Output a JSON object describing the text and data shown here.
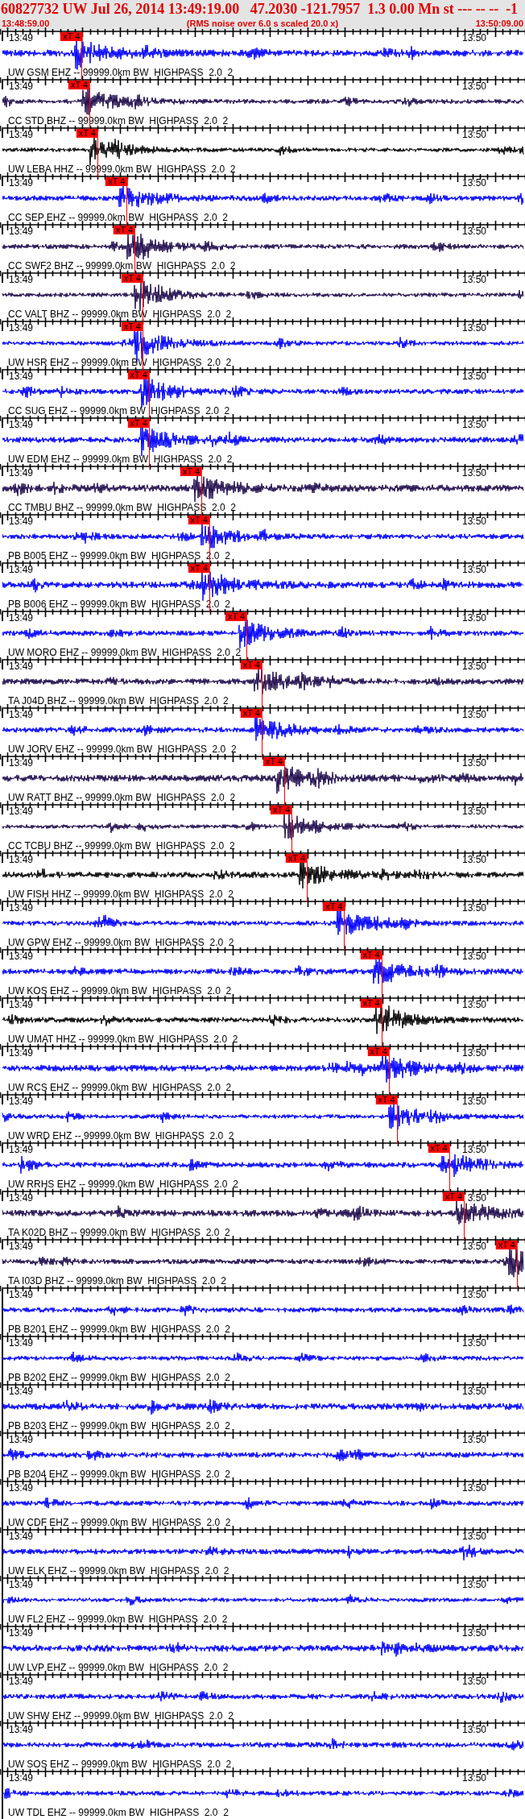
{
  "header": {
    "title": "60827732 UW Jul 26, 2014 13:49:19.00   47.2030 -121.7957  1.3 0.00 Mn st --- -- --  -1",
    "start_time": "13:48:59.00",
    "note": "(RMS noise over 6.0 s scaled 20.0 x)",
    "end_time": "13:50:09.00"
  },
  "traces": [
    {
      "label": "UW GSM EHZ -- 99999.0km BW  HIGHPASS  2.0  2",
      "color": "#0000ff",
      "start_label": "13:49",
      "end_label": "13:50",
      "pick": {
        "label": "xT 4",
        "level": 0.157
      }
    },
    {
      "label": "CC STD BHZ -- 99999.0km BW  HIGHPASS  2.0  2",
      "color": "#1e0a4b",
      "start_label": "13:49",
      "end_label": "13:50",
      "pick": {
        "label": "xT 4",
        "level": 0.172
      }
    },
    {
      "label": "UW LEBA HHZ -- 99999.0km BW  HIGHPASS  2.0  2",
      "color": "#000000",
      "start_label": "13:49",
      "end_label": "13:50",
      "pick": {
        "label": "xT 4",
        "level": 0.187
      }
    },
    {
      "label": "CC SEP EHZ -- 99999.0km BW  HIGHPASS  2.0  2",
      "color": "#0000ff",
      "start_label": "13:49",
      "end_label": "13:50",
      "pick": {
        "label": "xT 4",
        "level": 0.243
      }
    },
    {
      "label": "CC SWF2 BHZ -- 99999.0km BW  HIGHPASS  2.0  2",
      "color": "#1e0a4b",
      "start_label": "13:49",
      "end_label": "13:50",
      "pick": {
        "label": "xT 4",
        "level": 0.258
      }
    },
    {
      "label": "CC VALT BHZ -- 99999.0km BW  HIGHPASS  2.0  2",
      "color": "#1e0a4b",
      "start_label": "13:49",
      "end_label": "13:50",
      "pick": {
        "label": "xT 4",
        "level": 0.273
      }
    },
    {
      "label": "UW HSR EHZ -- 99999.0km BW  HIGHPASS  2.0  2",
      "color": "#0000ff",
      "start_label": "13:49",
      "end_label": "13:50",
      "pick": {
        "label": "xT 4",
        "level": 0.273
      }
    },
    {
      "label": "CC SUG EHZ -- 99999.0km BW  HIGHPASS  2.0  2",
      "color": "#0000ff",
      "start_label": "13:49",
      "end_label": "13:50",
      "pick": {
        "label": "xT 4",
        "level": 0.285
      }
    },
    {
      "label": "UW EDM EHZ -- 99999.0km BW  HIGHPASS  2.0  2",
      "color": "#0000ff",
      "start_label": "13:49",
      "end_label": "13:50",
      "pick": {
        "label": "xT 4",
        "level": 0.285
      }
    },
    {
      "label": "CC TMBU BHZ -- 99999.0km BW  HIGHPASS  2.0  2",
      "color": "#1e0a4b",
      "start_label": "13:49",
      "end_label": "13:50",
      "pick": {
        "label": "xT 4",
        "level": 0.385
      }
    },
    {
      "label": "PB B005 EHZ -- 99999.0km BW  HIGHPASS  2.0  2",
      "color": "#0000ff",
      "start_label": "13:49",
      "end_label": "13:50",
      "pick": {
        "label": "xT 4",
        "level": 0.4
      }
    },
    {
      "label": "PB B006 EHZ -- 99999.0km BW  HIGHPASS  2.0  2",
      "color": "#0000ff",
      "start_label": "13:49",
      "end_label": "13:50",
      "pick": {
        "label": "xT 4",
        "level": 0.4
      }
    },
    {
      "label": "UW MORO EHZ -- 99999.0km BW  HIGHPASS  2.0  2",
      "color": "#0000ff",
      "start_label": "13:49",
      "end_label": "13:50",
      "pick": {
        "label": "xT 4",
        "level": 0.471
      }
    },
    {
      "label": "TA J04D BHZ -- 99999.0km BW  HIGHPASS  2.0  2",
      "color": "#1e0a4b",
      "start_label": "13:49",
      "end_label": "13:50",
      "pick": {
        "label": "xT 4",
        "level": 0.5
      }
    },
    {
      "label": "UW JORV EHZ -- 99999.0km BW  HIGHPASS  2.0  2",
      "color": "#0000ff",
      "start_label": "13:49",
      "end_label": "13:50",
      "pick": {
        "label": "xT 4",
        "level": 0.5
      }
    },
    {
      "label": "UW RATT BHZ -- 99999.0km BW  HIGHPASS  2.0  2",
      "color": "#1e0a4b",
      "start_label": "13:49",
      "end_label": "13:50",
      "pick": {
        "label": "xT 4",
        "level": 0.543
      }
    },
    {
      "label": "CC TCBU BHZ -- 99999.0km BW  HIGHPASS  2.0  2",
      "color": "#1e0a4b",
      "start_label": "13:49",
      "end_label": "13:50",
      "pick": {
        "label": "xT 4",
        "level": 0.557
      }
    },
    {
      "label": "UW FISH HHZ -- 99999.0km BW  HIGHPASS  2.0  2",
      "color": "#000000",
      "start_label": "13:49",
      "end_label": "13:50",
      "pick": {
        "label": "xT 4",
        "level": 0.586
      }
    },
    {
      "label": "UW GPW EHZ -- 99999.0km BW  HIGHPASS  2.0  2",
      "color": "#0000ff",
      "start_label": "13:49",
      "end_label": "13:50",
      "pick": {
        "label": "xT 4",
        "level": 0.657
      }
    },
    {
      "label": "UW KOS EHZ -- 99999.0km BW  HIGHPASS  2.0  2",
      "color": "#0000ff",
      "start_label": "13:49",
      "end_label": "13:50",
      "pick": {
        "label": "xT 4",
        "level": 0.728
      }
    },
    {
      "label": "UW UMAT HHZ -- 99999.0km BW  HIGHPASS  2.0  2",
      "color": "#000000",
      "start_label": "13:49",
      "end_label": "13:50",
      "pick": {
        "label": "xT 4",
        "level": 0.728
      }
    },
    {
      "label": "UW RCS EHZ -- 99999.0km BW  HIGHPASS  2.0  2",
      "color": "#0000ff",
      "start_label": "13:49",
      "end_label": "13:50",
      "pick": {
        "label": "xT 4",
        "level": 0.742
      }
    },
    {
      "label": "UW WRD EHZ -- 99999.0km BW  HIGHPASS  2.0  2",
      "color": "#0000ff",
      "start_label": "13:49",
      "end_label": "13:50",
      "pick": {
        "label": "xT 4",
        "level": 0.757
      }
    },
    {
      "label": "UW RRHS EHZ -- 99999.0km BW  HIGHPASS  2.0  2",
      "color": "#0000ff",
      "start_label": "13:49",
      "end_label": "13:50",
      "pick": {
        "label": "xT 4",
        "level": 0.857
      }
    },
    {
      "label": "TA K02D BHZ -- 99999.0km BW  HIGHPASS  2.0  2",
      "color": "#1e0a4b",
      "start_label": "13:49",
      "end_label": "3:50",
      "pick": {
        "label": "xT 4",
        "level": 0.885
      }
    },
    {
      "label": "TA I03D BHZ -- 99999.0km BW  HIGHPASS  2.0  2",
      "color": "#1e0a4b",
      "start_label": "13:49",
      "end_label": "13:50",
      "pick": {
        "label": "xT 4",
        "level": 0.986
      }
    },
    {
      "label": "PB B201 EHZ -- 99999.0km BW  HIGHPASS  2.0  2",
      "color": "#0000ff",
      "start_label": "13:49",
      "end_label": "13:50"
    },
    {
      "label": "PB B202 EHZ -- 99999.0km BW  HIGHPASS  2.0  2",
      "color": "#0000ff",
      "start_label": "13:49",
      "end_label": "13:50"
    },
    {
      "label": "PB B203 EHZ -- 99999.0km BW  HIGHPASS  2.0  2",
      "color": "#0000ff",
      "start_label": "13:49",
      "end_label": "13:50"
    },
    {
      "label": "PB B204 EHZ -- 99999.0km BW  HIGHPASS  2.0  2",
      "color": "#0000ff",
      "start_label": "13:49",
      "end_label": "13:50"
    },
    {
      "label": "UW CDF EHZ -- 99999.0km BW  HIGHPASS  2.0  2",
      "color": "#0000ff",
      "start_label": "13:49",
      "end_label": "13:50"
    },
    {
      "label": "UW ELK EHZ -- 99999.0km BW  HIGHPASS  2.0  2",
      "color": "#0000ff",
      "start_label": "13:49",
      "end_label": "13:50"
    },
    {
      "label": "UW FL2 EHZ -- 99999.0km BW  HIGHPASS  2.0  2",
      "color": "#0000ff",
      "start_label": "13:49",
      "end_label": "13:50"
    },
    {
      "label": "UW LVP EHZ -- 99999.0km BW  HIGHPASS  2.0  2",
      "color": "#0000ff",
      "start_label": "13:49",
      "end_label": "13:50"
    },
    {
      "label": "UW SHW EHZ -- 99999.0km BW  HIGHPASS  2.0  2",
      "color": "#0000ff",
      "start_label": "13:49",
      "end_label": "13:50"
    },
    {
      "label": "UW SOS EHZ -- 99999.0km BW  HIGHPASS  2.0  2",
      "color": "#0000ff",
      "start_label": "13:49",
      "end_label": "13:50"
    },
    {
      "label": "UW TDL EHZ -- 99999.0km BW  HIGHPASS  2.0  2",
      "color": "#0000ff",
      "start_label": "13:49",
      "end_label": "13:50"
    }
  ]
}
